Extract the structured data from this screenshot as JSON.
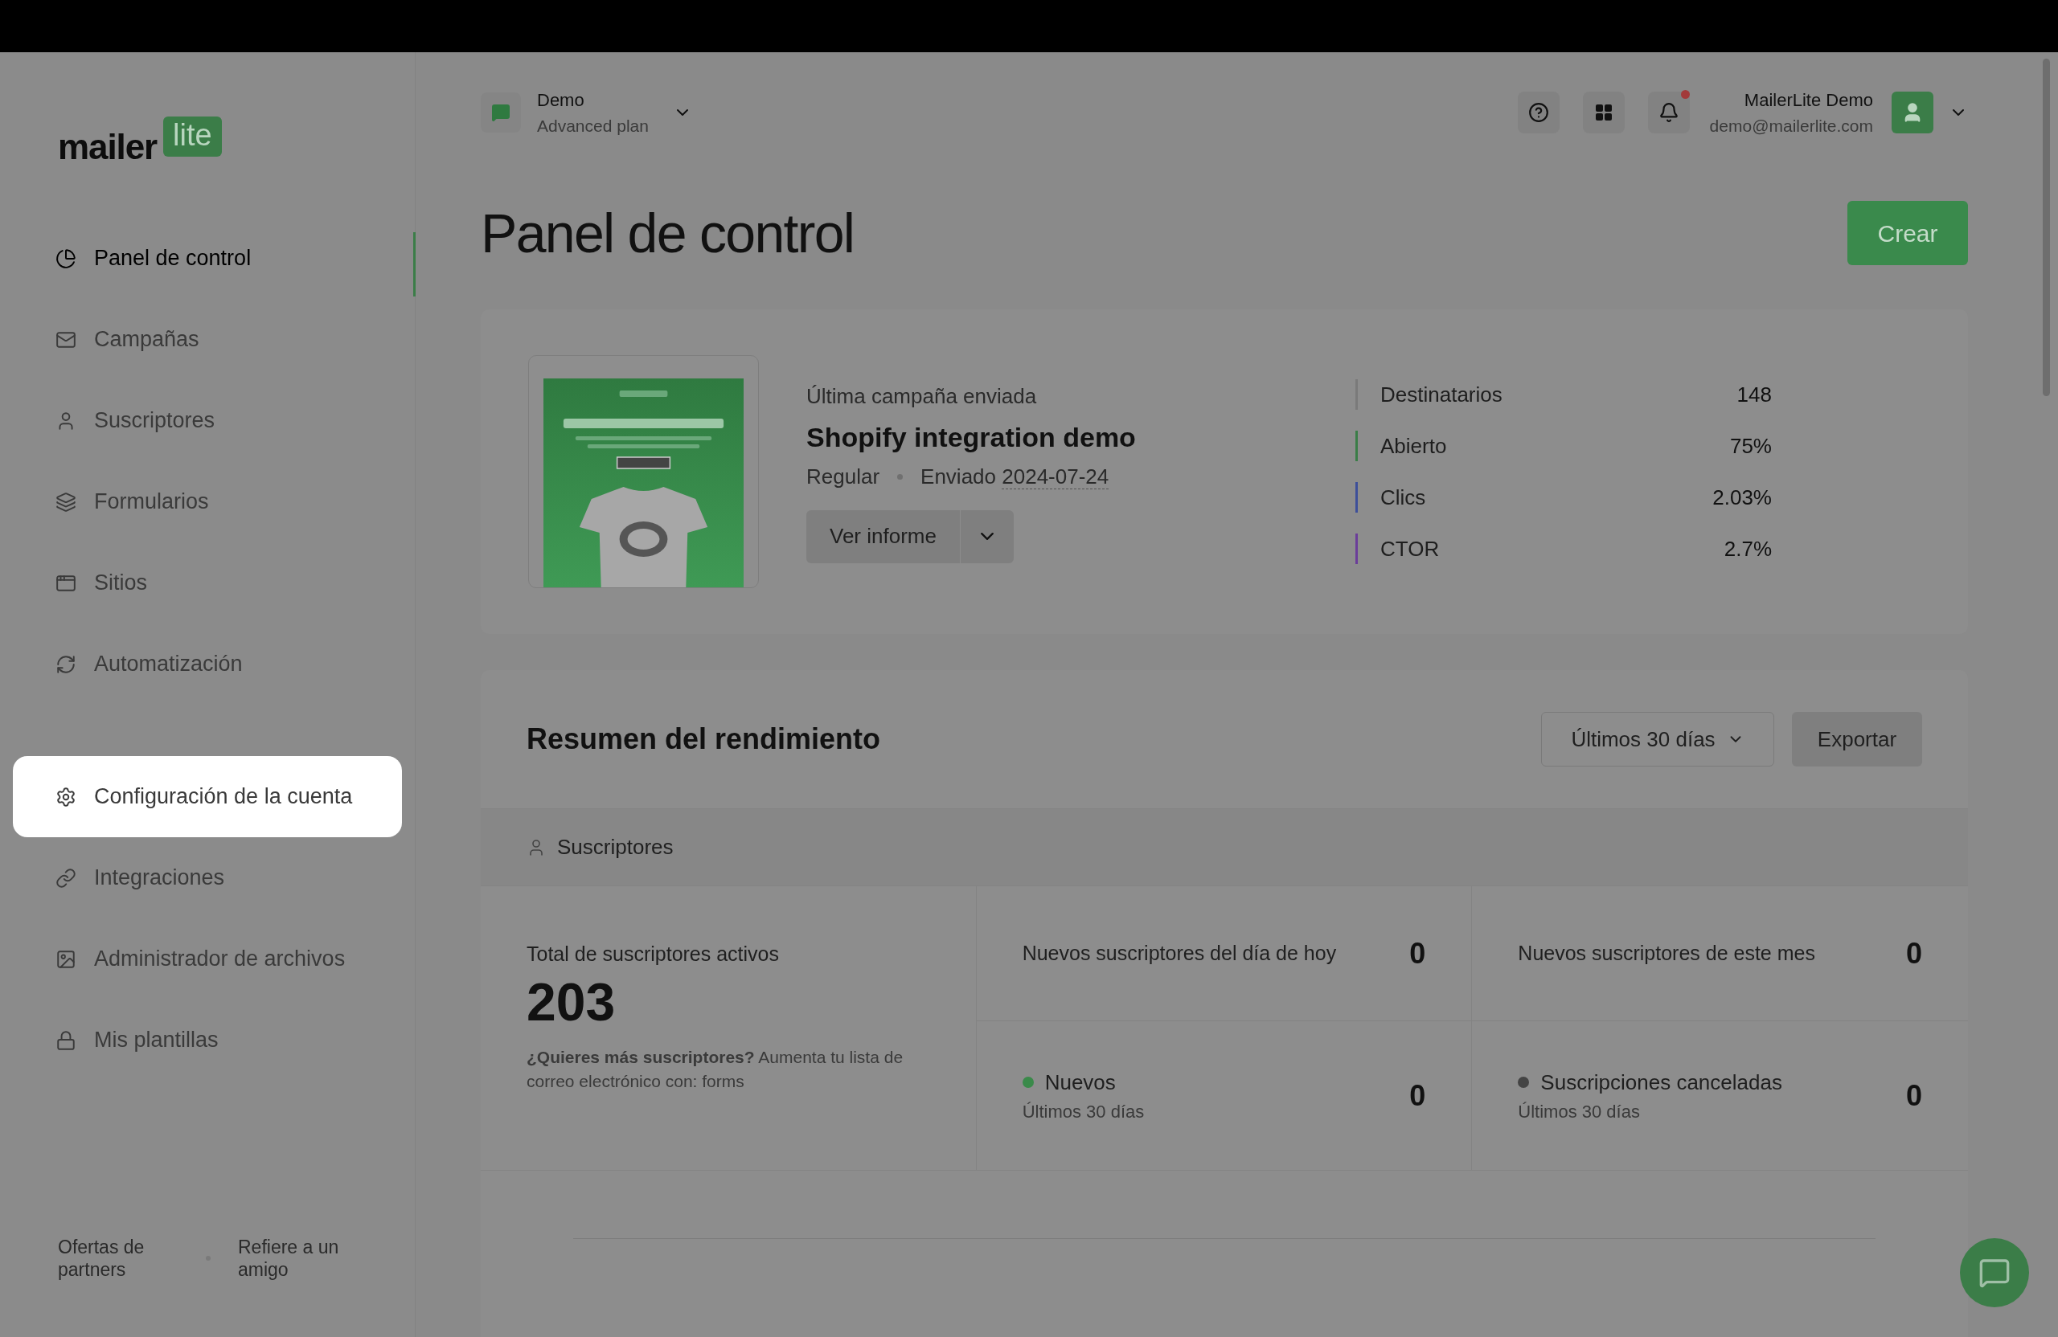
{
  "top_bar": {
    "account": {
      "name": "Demo",
      "plan": "Advanced plan"
    },
    "notifications": {
      "unread": true
    },
    "user": {
      "name": "MailerLite Demo",
      "email": "demo@mailerlite.com"
    }
  },
  "sidebar": {
    "logo": {
      "word": "mailer",
      "badge": "lite"
    },
    "items": [
      {
        "label": "Panel de control",
        "selected": true,
        "highlighted": false
      },
      {
        "label": "Campañas",
        "selected": false,
        "highlighted": false
      },
      {
        "label": "Suscriptores",
        "selected": false,
        "highlighted": false
      },
      {
        "label": "Formularios",
        "selected": false,
        "highlighted": false
      },
      {
        "label": "Sitios",
        "selected": false,
        "highlighted": false
      },
      {
        "label": "Automatización",
        "selected": false,
        "highlighted": false
      },
      {
        "label": "Configuración de la cuenta",
        "selected": false,
        "highlighted": true
      },
      {
        "label": "Integraciones",
        "selected": false,
        "highlighted": false
      },
      {
        "label": "Administrador de archivos",
        "selected": false,
        "highlighted": false
      },
      {
        "label": "Mis plantillas",
        "selected": false,
        "highlighted": false
      }
    ],
    "footer_links": [
      "Ofertas de partners",
      "Refiere a un amigo"
    ]
  },
  "page": {
    "title": "Panel de control",
    "create_button": "Crear"
  },
  "last_campaign": {
    "caption": "Última campaña enviada",
    "name": "Shopify integration demo",
    "type": "Regular",
    "sent_label": "Enviado",
    "sent_date": "2024-07-24",
    "report_button": "Ver informe",
    "stats": [
      {
        "label": "Destinatarios",
        "value": "148",
        "color": "#7a7a7a"
      },
      {
        "label": "Abierto",
        "value": "75%",
        "color": "#3a7d47"
      },
      {
        "label": "Clics",
        "value": "2.03%",
        "color": "#3d4f9a"
      },
      {
        "label": "CTOR",
        "value": "2.7%",
        "color": "#6b3d9a"
      }
    ]
  },
  "performance": {
    "title": "Resumen del rendimiento",
    "period": "Últimos 30 días",
    "export_button": "Exportar",
    "section": "Suscriptores",
    "total": {
      "label": "Total de suscriptores activos",
      "value": "203",
      "hint": "**¿Quieres más suscriptores?** Aumenta tu lista de correo electrónico con: forms"
    },
    "cells": [
      {
        "kind": "metric",
        "label": "Nuevos suscriptores del día de hoy",
        "value": "0"
      },
      {
        "kind": "metric",
        "label": "Nuevos suscriptores de este mes",
        "value": "0"
      },
      {
        "kind": "legend",
        "label": "Nuevos",
        "sublabel": "Últimos 30 días",
        "value": "0",
        "color": "#3a8a4a"
      },
      {
        "kind": "legend",
        "label": "Suscripciones canceladas",
        "sublabel": "Últimos 30 días",
        "value": "0",
        "color": "#444444"
      }
    ]
  }
}
